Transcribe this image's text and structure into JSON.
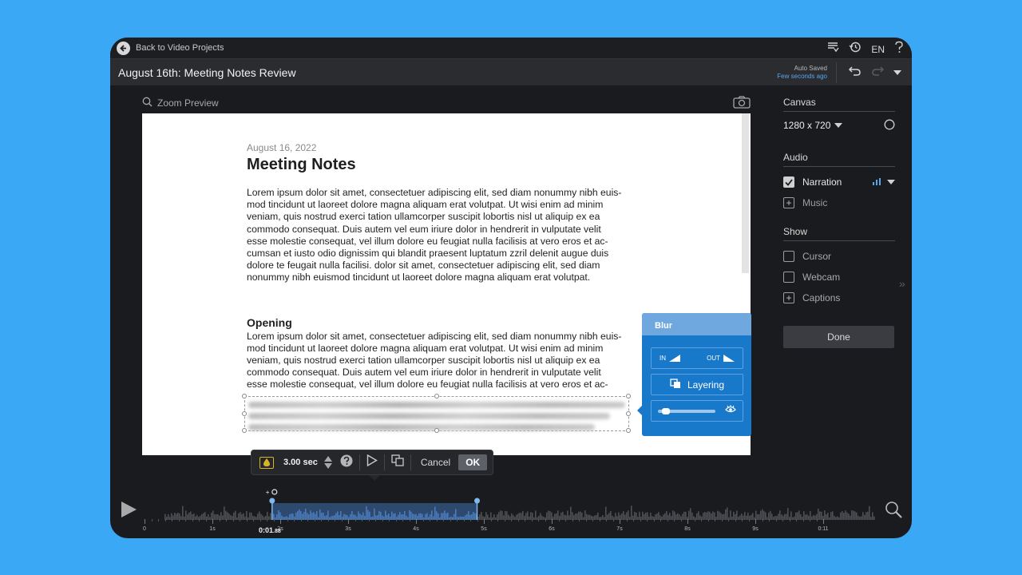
{
  "topbar": {
    "back_label": "Back to Video Projects",
    "language": "EN"
  },
  "project": {
    "title": "August 16th: Meeting Notes Review"
  },
  "autosave": {
    "status": "Auto Saved",
    "time": "Few seconds ago"
  },
  "preview": {
    "zoom_label": "Zoom Preview"
  },
  "document": {
    "date": "August 16, 2022",
    "title": "Meeting Notes",
    "paragraph1_lines": [
      "Lorem ipsum dolor sit amet, consectetuer adipiscing elit, sed diam nonummy nibh euis-",
      "mod tincidunt ut laoreet dolore magna aliquam erat volutpat. Ut wisi enim ad minim",
      "veniam, quis nostrud exerci tation ullamcorper suscipit lobortis nisl ut aliquip ex ea",
      "commodo consequat. Duis autem vel eum iriure dolor in hendrerit in vulputate velit",
      "esse molestie consequat, vel illum dolore eu feugiat nulla facilisis at vero eros et ac-",
      "cumsan et iusto odio dignissim qui blandit praesent luptatum zzril delenit augue duis",
      "dolore te feugait nulla facilisi. dolor sit amet, consectetuer adipiscing elit, sed diam",
      "nonummy nibh euismod tincidunt ut laoreet dolore magna aliquam erat volutpat."
    ],
    "heading": "Opening",
    "paragraph2_lines": [
      "Lorem ipsum dolor sit amet, consectetuer adipiscing elit, sed diam nonummy nibh euis-",
      "mod tincidunt ut laoreet dolore magna aliquam erat volutpat. Ut wisi enim ad minim",
      "veniam, quis nostrud exerci tation ullamcorper suscipit lobortis nisl ut aliquip ex ea",
      "commodo consequat. Duis autem vel eum iriure dolor in hendrerit in vulputate velit",
      "esse molestie consequat, vel illum dolore eu feugiat nulla facilisis at vero eros et ac-"
    ]
  },
  "blur_panel": {
    "title": "Blur",
    "in_label": "IN",
    "out_label": "OUT",
    "layering_label": "Layering",
    "blur_amount": 0.08
  },
  "effect_toolbar": {
    "duration": "3.00 sec",
    "cancel_label": "Cancel",
    "ok_label": "OK"
  },
  "sidebar": {
    "canvas_title": "Canvas",
    "canvas_size": "1280 x 720",
    "audio_title": "Audio",
    "narration_label": "Narration",
    "narration_checked": true,
    "music_label": "Music",
    "show_title": "Show",
    "cursor_label": "Cursor",
    "webcam_label": "Webcam",
    "captions_label": "Captions",
    "done_label": "Done"
  },
  "timeline": {
    "current_time_label": "0:01",
    "current_time_frac": ".88",
    "tick_labels": [
      "0",
      "1s",
      "2s",
      "3s",
      "4s",
      "5s",
      "6s",
      "7s",
      "8s",
      "9s",
      "0:11"
    ],
    "selection_start": 1.88,
    "selection_end": 4.9,
    "duration": 11
  },
  "colors": {
    "accent": "#58a7ec",
    "blur_panel": "#1878c9",
    "background": "#3aa8f5"
  }
}
